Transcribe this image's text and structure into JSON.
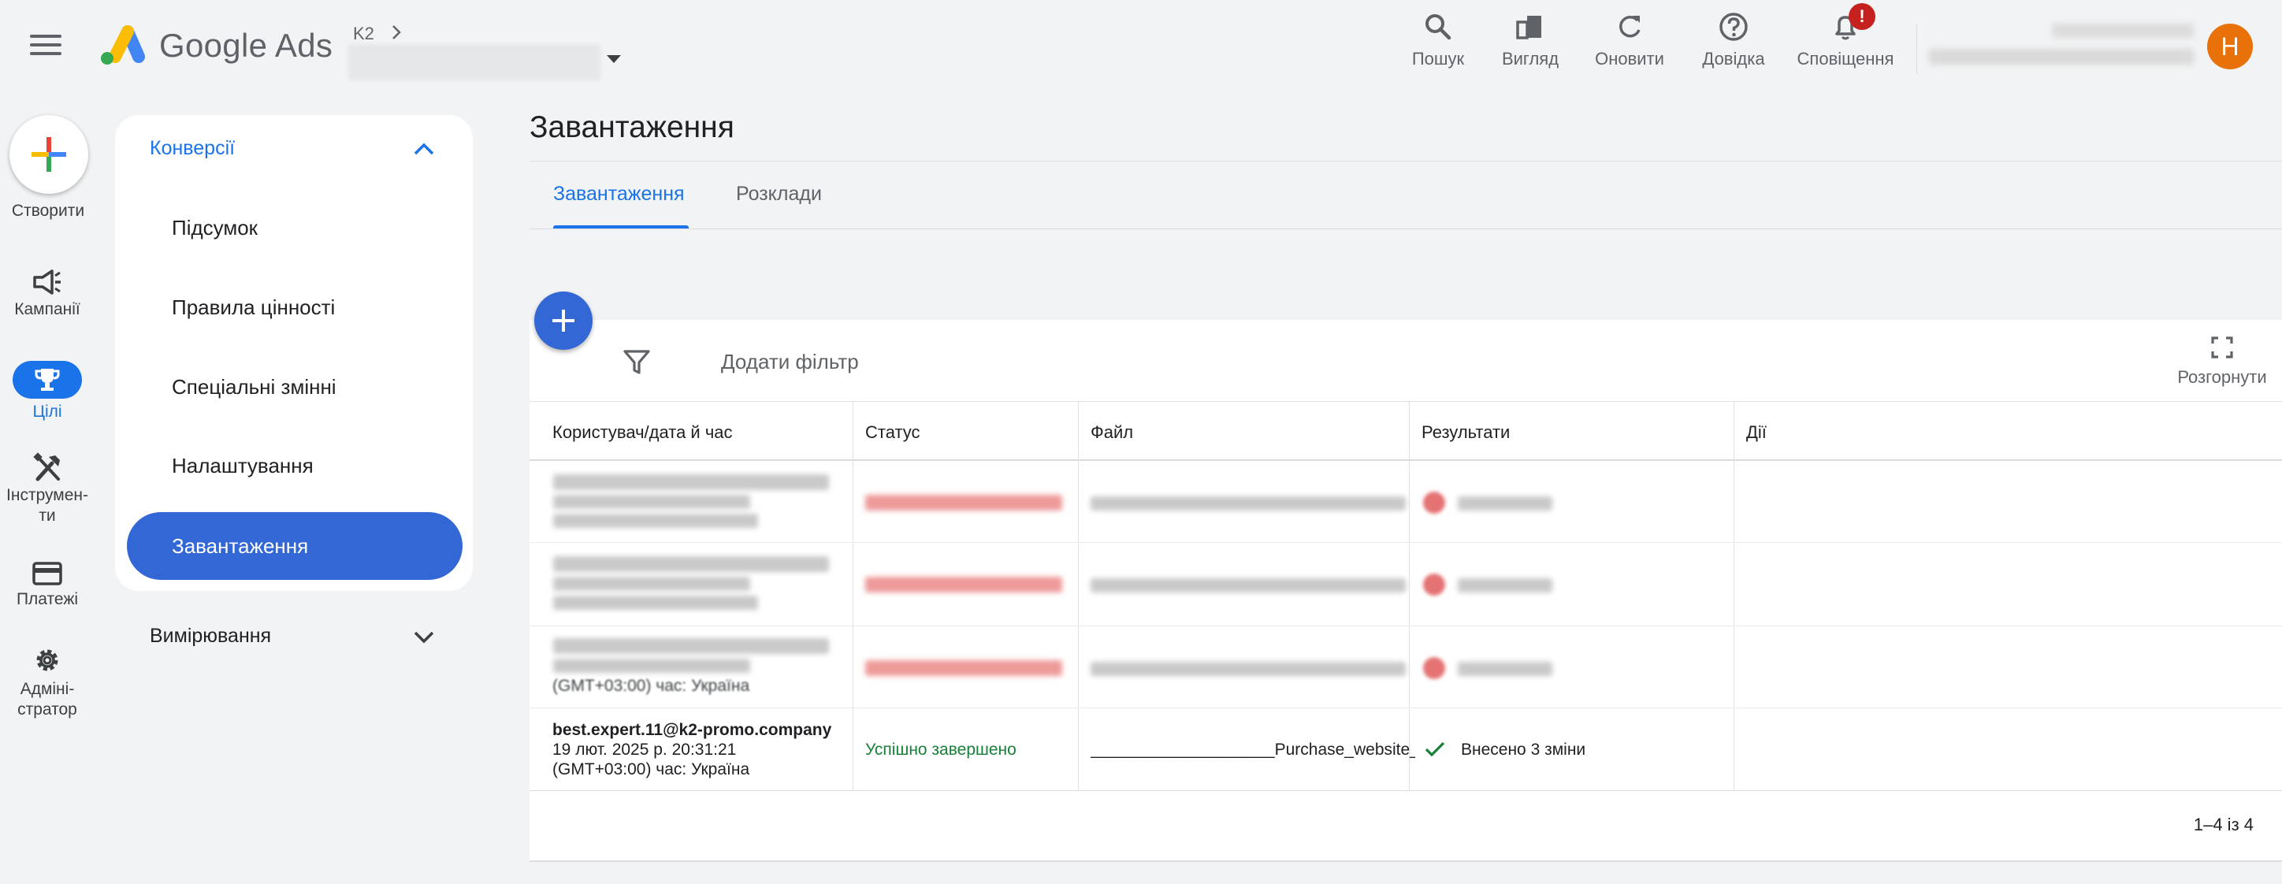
{
  "header": {
    "product_name": "Google Ads",
    "account_short": "K2",
    "buttons": {
      "search": "Пошук",
      "view": "Вигляд",
      "refresh": "Оновити",
      "help": "Довідка",
      "notifications": "Сповіщення"
    },
    "notification_badge": "!",
    "avatar_letter": "Н"
  },
  "rail": {
    "create": "Створити",
    "campaigns": "Кампанії",
    "goals": "Цілі",
    "tools": "Інструмен-\nти",
    "billing": "Платежі",
    "admin": "Адміні-\nстратор"
  },
  "nav": {
    "section_conversions": "Конверсії",
    "items": [
      "Підсумок",
      "Правила цінності",
      "Спеціальні змінні",
      "Налаштування"
    ],
    "active_item": "Завантаження",
    "section_measurement": "Вимірювання"
  },
  "main": {
    "title": "Завантаження",
    "tabs": [
      "Завантаження",
      "Розклади"
    ],
    "add_filter": "Додати фільтр",
    "expand": "Розгорнути",
    "columns": [
      "Користувач/дата й час",
      "Статус",
      "Файл",
      "Результати",
      "Дії"
    ],
    "visible_row_fragment": "(GMT+03:00) час: Україна",
    "last_row": {
      "user": "best.expert.11@k2-promo.company",
      "date": "19 лют. 2025 р. 20:31:21",
      "tz": "(GMT+03:00) час: Україна",
      "status": "Успішно завершено",
      "file": "____________________Purchase_website_",
      "result": "Внесено 3 зміни"
    },
    "pagination": "1–4 із 4"
  },
  "colors": {
    "accent": "#1a73e8",
    "active_nav": "#3367d6",
    "success": "#188038",
    "avatar": "#e8710a",
    "badge": "#c5221f"
  }
}
